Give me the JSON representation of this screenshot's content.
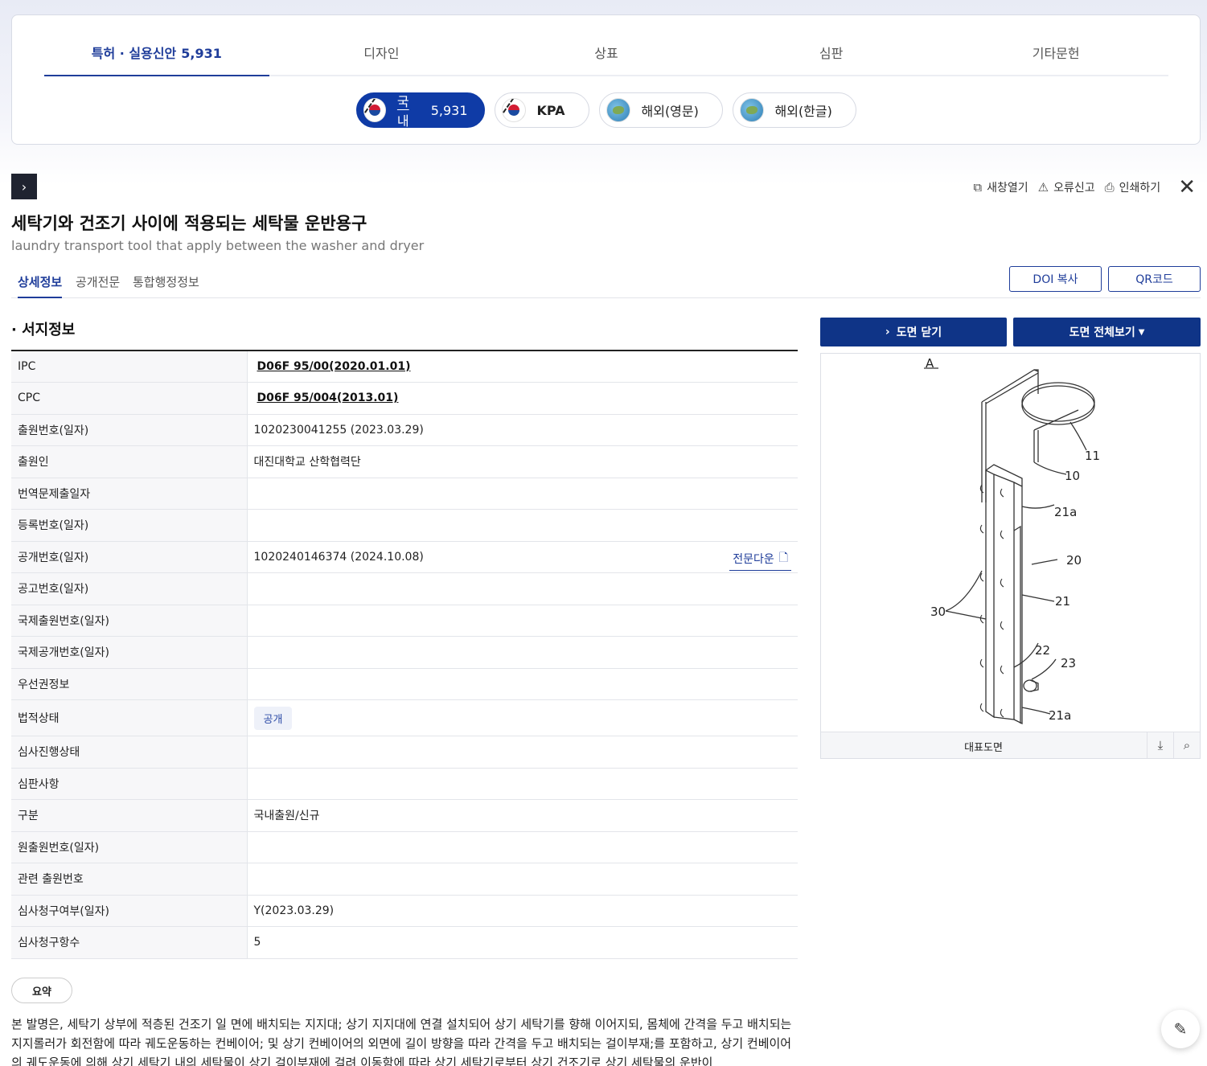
{
  "main_tabs": [
    {
      "label": "특허 · 실용신안",
      "count": "5,931"
    },
    {
      "label": "디자인"
    },
    {
      "label": "상표"
    },
    {
      "label": "심판"
    },
    {
      "label": "기타문헌"
    }
  ],
  "sub_tabs": [
    {
      "label": "국내",
      "count": "5,931",
      "icon": "korea-flag-icon"
    },
    {
      "label": "KPA",
      "icon": "korea-flag-icon"
    },
    {
      "label": "해외(영문)",
      "icon": "globe-icon"
    },
    {
      "label": "해외(한글)",
      "icon": "globe-icon"
    }
  ],
  "actions": {
    "new_window": "새창열기",
    "report_error": "오류신고",
    "print": "인쇄하기"
  },
  "title_ko": "세탁기와 건조기 사이에 적용되는 세탁물 운반용구",
  "title_en": "laundry transport tool that apply between the washer and dryer",
  "detail_tabs": [
    "상세정보",
    "공개전문",
    "통합행정정보"
  ],
  "doi_copy": "DOI 복사",
  "qr_code": "QR코드",
  "section_title": "· 서지정보",
  "biblio": {
    "ipc": {
      "label": "IPC",
      "value": "D06F 95/00(2020.01.01)"
    },
    "cpc": {
      "label": "CPC",
      "value": "D06F 95/004(2013.01)"
    },
    "app_no": {
      "label": "출원번호(일자)",
      "value": "1020230041255 (2023.03.29)"
    },
    "applicant": {
      "label": "출원인",
      "value": "대진대학교 산학협력단"
    },
    "translation": {
      "label": "번역문제출일자",
      "value": ""
    },
    "reg_no": {
      "label": "등록번호(일자)",
      "value": ""
    },
    "pub_no": {
      "label": "공개번호(일자)",
      "value": "1020240146374 (2024.10.08)",
      "download": "전문다운"
    },
    "notice_no": {
      "label": "공고번호(일자)",
      "value": ""
    },
    "intl_app_no": {
      "label": "국제출원번호(일자)",
      "value": ""
    },
    "intl_pub_no": {
      "label": "국제공개번호(일자)",
      "value": ""
    },
    "priority": {
      "label": "우선권정보",
      "value": ""
    },
    "legal_status": {
      "label": "법적상태",
      "value": "공개"
    },
    "exam_status": {
      "label": "심사진행상태",
      "value": ""
    },
    "trial": {
      "label": "심판사항",
      "value": ""
    },
    "category": {
      "label": "구분",
      "value": "국내출원/신규"
    },
    "orig_app_no": {
      "label": "원출원번호(일자)",
      "value": ""
    },
    "related_app": {
      "label": "관련 출원번호",
      "value": ""
    },
    "exam_request": {
      "label": "심사청구여부(일자)",
      "value": "Y(2023.03.29)"
    },
    "claims_count": {
      "label": "심사청구항수",
      "value": "5"
    }
  },
  "summary_label": "요약",
  "summary_text": "본 발명은, 세탁기 상부에 적층된 건조기 일 면에 배치되는 지지대; 상기 지지대에 연결 설치되어 상기 세탁기를 향해 이어지되, 몸체에 간격을 두고 배치되는 지지롤러가 회전함에 따라 궤도운동하는 컨베이어; 및 상기 컨베이어의 외면에 길이 방향을 따라 간격을 두고 배치되는 걸이부재;를 포함하고, 상기 컨베이어의 궤도운동에 의해 상기 세탁기 내의 세탁물이 상기 걸이부재에 걸려 이동함에 따라 상기 세탁기로부터 상기 건조기로 상기 세탁물의 운반이",
  "drawing": {
    "close_label": "도면 닫기",
    "full_view_label": "도면 전체보기",
    "caption": "대표도면",
    "labels": {
      "fig": "A",
      "l11": "11",
      "l10": "10",
      "l21a_top": "21a",
      "l20": "20",
      "l21": "21",
      "l30": "30",
      "l22": "22",
      "l23": "23",
      "l21a_bot": "21a"
    }
  }
}
